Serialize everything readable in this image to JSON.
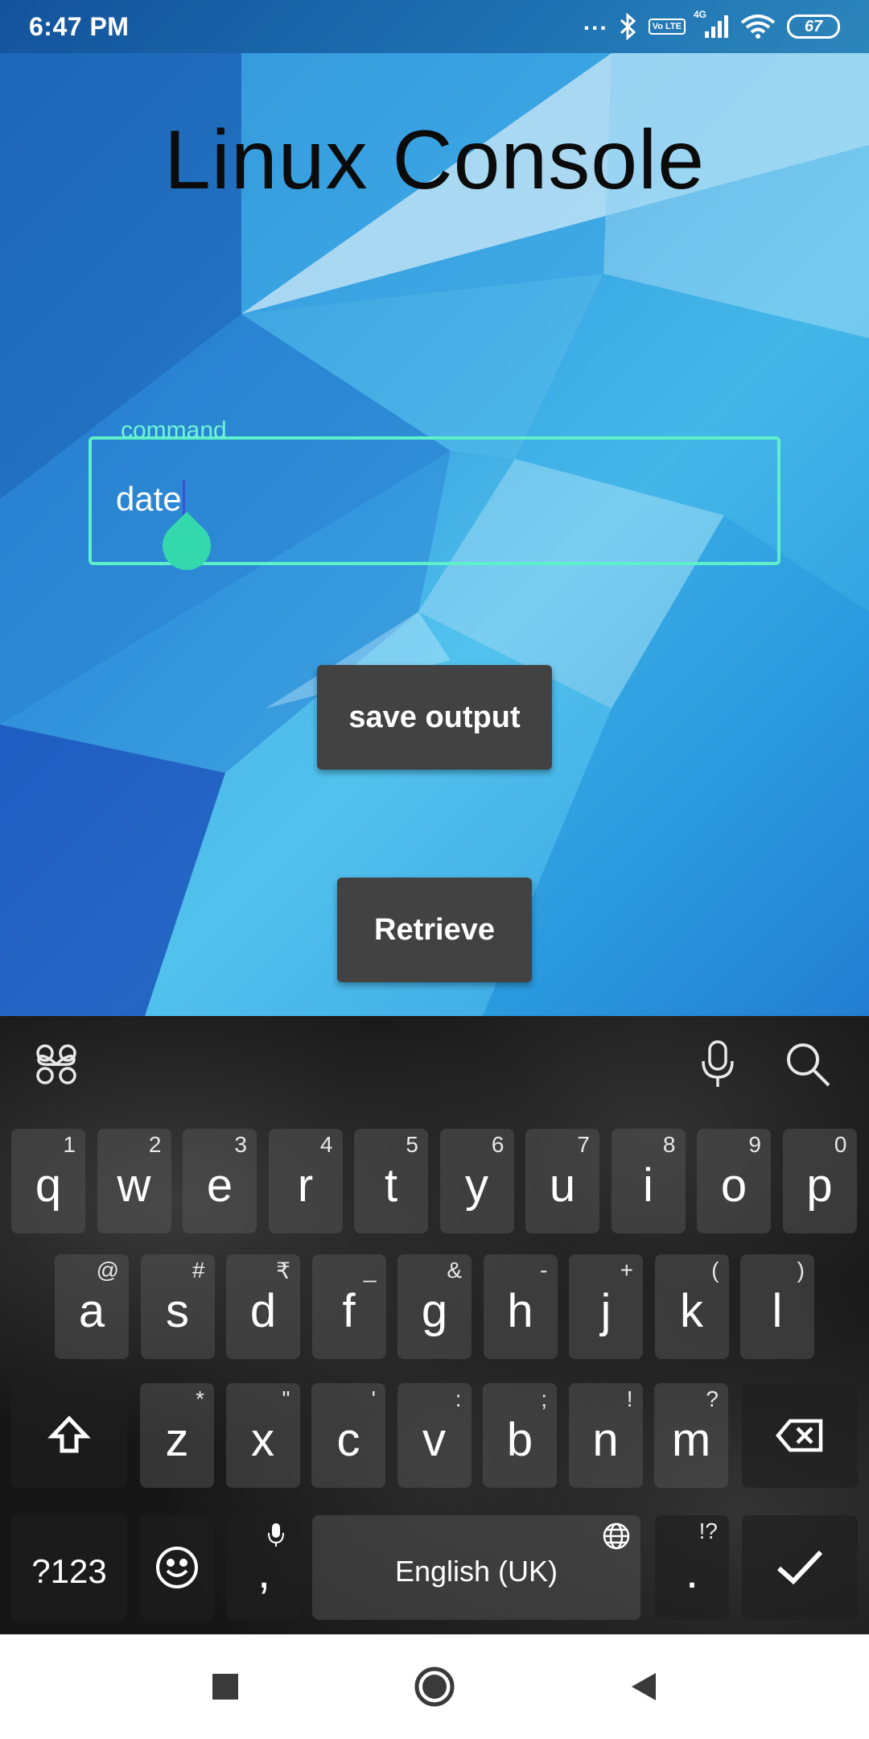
{
  "status_bar": {
    "time": "6:47 PM",
    "dots": "...",
    "volte": "Vo LTE",
    "network": "4G",
    "battery": "67"
  },
  "app": {
    "title": "Linux Console",
    "command_field": {
      "label": "command",
      "value": "date"
    },
    "buttons": {
      "save": "save output",
      "retrieve": "Retrieve"
    }
  },
  "keyboard": {
    "row1": [
      {
        "key": "q",
        "hint": "1"
      },
      {
        "key": "w",
        "hint": "2"
      },
      {
        "key": "e",
        "hint": "3"
      },
      {
        "key": "r",
        "hint": "4"
      },
      {
        "key": "t",
        "hint": "5"
      },
      {
        "key": "y",
        "hint": "6"
      },
      {
        "key": "u",
        "hint": "7"
      },
      {
        "key": "i",
        "hint": "8"
      },
      {
        "key": "o",
        "hint": "9"
      },
      {
        "key": "p",
        "hint": "0"
      }
    ],
    "row2": [
      {
        "key": "a",
        "hint": "@"
      },
      {
        "key": "s",
        "hint": "#"
      },
      {
        "key": "d",
        "hint": "₹"
      },
      {
        "key": "f",
        "hint": "_"
      },
      {
        "key": "g",
        "hint": "&"
      },
      {
        "key": "h",
        "hint": "-"
      },
      {
        "key": "j",
        "hint": "+"
      },
      {
        "key": "k",
        "hint": "("
      },
      {
        "key": "l",
        "hint": ")"
      }
    ],
    "row3": [
      {
        "key": "z",
        "hint": "*"
      },
      {
        "key": "x",
        "hint": "\""
      },
      {
        "key": "c",
        "hint": "'"
      },
      {
        "key": "v",
        "hint": ":"
      },
      {
        "key": "b",
        "hint": ";"
      },
      {
        "key": "n",
        "hint": "!"
      },
      {
        "key": "m",
        "hint": "?"
      }
    ],
    "symbols_key": "?123",
    "comma_key": ",",
    "space_label": "English (UK)",
    "period_key": ".",
    "period_hint": "!?"
  }
}
